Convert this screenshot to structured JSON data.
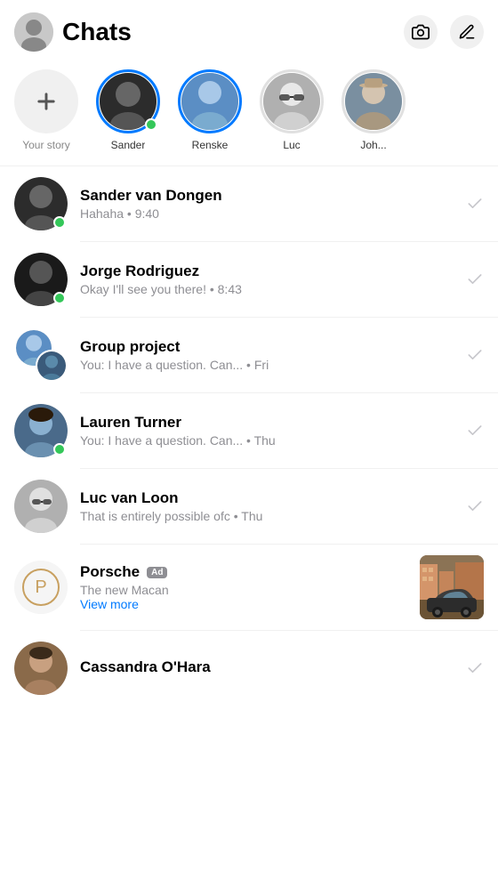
{
  "header": {
    "title": "Chats",
    "avatar_emoji": "🧑",
    "camera_label": "camera",
    "compose_label": "compose"
  },
  "stories": {
    "your_story_label": "Your story",
    "items": [
      {
        "id": "sander",
        "name": "Sander",
        "emoji": "🧔",
        "ring": true,
        "online": true
      },
      {
        "id": "renske",
        "name": "Renske",
        "emoji": "👱‍♀️",
        "ring": true,
        "online": false
      },
      {
        "id": "luc",
        "name": "Luc",
        "emoji": "👨‍🚀",
        "ring": false,
        "online": false
      },
      {
        "id": "joh",
        "name": "Joh...",
        "emoji": "🧓",
        "ring": false,
        "online": false
      }
    ]
  },
  "chats": [
    {
      "id": "sander-van-dongen",
      "name": "Sander van Dongen",
      "preview": "Hahaha • 9:40",
      "emoji": "🧔",
      "online": true,
      "group": false,
      "ad": false
    },
    {
      "id": "jorge-rodriguez",
      "name": "Jorge Rodriguez",
      "preview": "Okay I'll see you there! • 8:43",
      "emoji": "🧑",
      "online": true,
      "group": false,
      "ad": false
    },
    {
      "id": "group-project",
      "name": "Group project",
      "preview": "You: I have a question. Can... • Fri",
      "emoji1": "👱‍♀️",
      "emoji2": "🧑",
      "online": false,
      "group": true,
      "ad": false
    },
    {
      "id": "lauren-turner",
      "name": "Lauren Turner",
      "preview": "You: I have a question. Can... • Thu",
      "emoji": "👩‍🦱",
      "online": true,
      "group": false,
      "ad": false
    },
    {
      "id": "luc-van-loon",
      "name": "Luc van Loon",
      "preview": "That is entirely possible ofc • Thu",
      "emoji": "👨‍🚀",
      "online": false,
      "group": false,
      "ad": false
    },
    {
      "id": "porsche-ad",
      "name": "Porsche",
      "ad_badge": "Ad",
      "preview_line1": "The new Macan",
      "preview_line2": "View more",
      "emoji": "🏎",
      "online": false,
      "group": false,
      "ad": true
    },
    {
      "id": "cassandra-ohara",
      "name": "Cassandra O'Hara",
      "preview": "",
      "emoji": "👩",
      "online": false,
      "group": false,
      "ad": false
    }
  ]
}
